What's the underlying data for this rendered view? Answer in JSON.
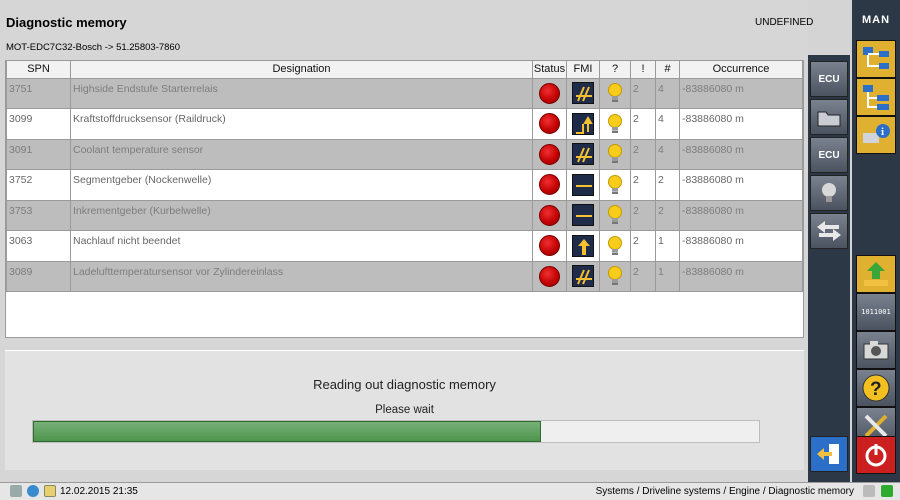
{
  "header": {
    "title": "Diagnostic memory",
    "status": "UNDEFINED",
    "ecu_path": "MOT-EDC7C32-Bosch -> 51.25803-7860"
  },
  "table": {
    "columns": [
      "SPN",
      "Designation",
      "Status",
      "FMI",
      "?",
      "!",
      "#",
      "Occurrence"
    ],
    "rows": [
      {
        "spn": "3751",
        "designation": "Highside Endstufe Starterrelais",
        "fmi": "slash",
        "bang": "2",
        "count": "4",
        "occurrence": "-83886080 m"
      },
      {
        "spn": "3099",
        "designation": "Kraftstoffdrucksensor (Raildruck)",
        "fmi": "up-arrows",
        "bang": "2",
        "count": "4",
        "occurrence": "-83886080 m"
      },
      {
        "spn": "3091",
        "designation": "Coolant temperature sensor",
        "fmi": "slash",
        "bang": "2",
        "count": "4",
        "occurrence": "-83886080 m"
      },
      {
        "spn": "3752",
        "designation": "Segmentgeber (Nockenwelle)",
        "fmi": "flat",
        "bang": "2",
        "count": "2",
        "occurrence": "-83886080 m"
      },
      {
        "spn": "3753",
        "designation": "Inkrementgeber (Kurbelwelle)",
        "fmi": "flat",
        "bang": "2",
        "count": "2",
        "occurrence": "-83886080 m"
      },
      {
        "spn": "3063",
        "designation": "Nachlauf nicht beendet",
        "fmi": "up-arrow",
        "bang": "2",
        "count": "1",
        "occurrence": "-83886080 m"
      },
      {
        "spn": "3089",
        "designation": "Ladelufttemperatursensor vor Zylindereinlass",
        "fmi": "slash",
        "bang": "2",
        "count": "1",
        "occurrence": "-83886080 m"
      }
    ]
  },
  "progress": {
    "title": "Reading out diagnostic memory",
    "subtitle": "Please wait",
    "fraction": 0.7
  },
  "sidebar": {
    "ecu_label": "ECU",
    "brand": "MAN",
    "bits_label": "1011001"
  },
  "statusbar": {
    "datetime": "12.02.2015 21:35",
    "breadcrumb": "Systems / Driveline systems / Engine / Diagnostic memory"
  },
  "colors": {
    "status_red": "#d00000",
    "progress_green": "#5ea05e",
    "sidebar_bg": "#2c3846",
    "row_gray": "#bdbdbd"
  }
}
